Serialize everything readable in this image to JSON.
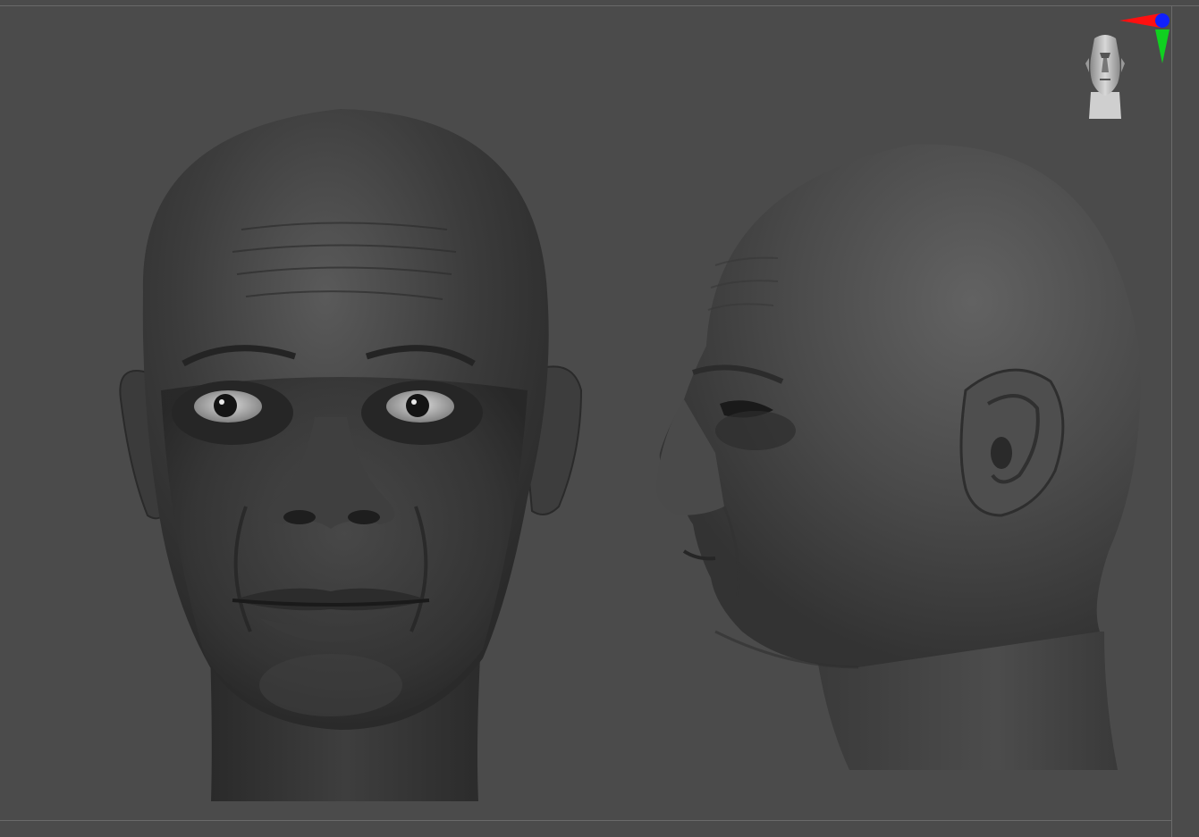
{
  "viewport": {
    "background_color": "#4b4b4b",
    "frame_color": "#6a6a6a"
  },
  "model": {
    "material_color": "#3a3a3a",
    "views": [
      "front",
      "side-profile"
    ]
  },
  "navigation": {
    "icon": "head-navigation-icon"
  },
  "gizmo": {
    "icon": "axis-gizmo-icon",
    "x_axis_color": "#ff1010",
    "y_axis_color": "#10d020",
    "z_axis_color": "#1020ff"
  }
}
